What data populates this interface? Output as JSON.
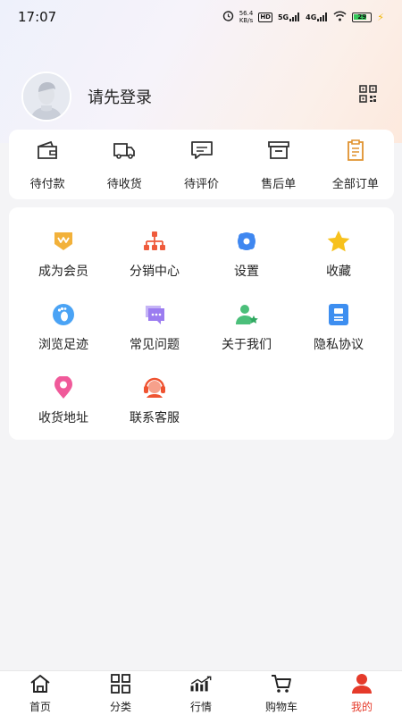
{
  "status_bar": {
    "time": "17:07",
    "net_speed": "56.4",
    "net_unit": "KB/s",
    "hd_label": "HD",
    "net_5g": "5G",
    "net_4g": "4G",
    "battery": "29"
  },
  "profile": {
    "login_prompt": "请先登录"
  },
  "orders": [
    {
      "label": "待付款",
      "icon": "wallet-icon"
    },
    {
      "label": "待收货",
      "icon": "truck-icon"
    },
    {
      "label": "待评价",
      "icon": "comment-icon"
    },
    {
      "label": "售后单",
      "icon": "archive-box-icon"
    },
    {
      "label": "全部订单",
      "icon": "clipboard-icon"
    }
  ],
  "services": [
    {
      "label": "成为会员",
      "icon": "vip-badge-icon"
    },
    {
      "label": "分销中心",
      "icon": "distribution-tree-icon"
    },
    {
      "label": "设置",
      "icon": "gear-icon"
    },
    {
      "label": "收藏",
      "icon": "star-icon"
    },
    {
      "label": "浏览足迹",
      "icon": "footprint-icon"
    },
    {
      "label": "常见问题",
      "icon": "chat-bubble-icon"
    },
    {
      "label": "关于我们",
      "icon": "user-star-icon"
    },
    {
      "label": "隐私协议",
      "icon": "privacy-book-icon"
    },
    {
      "label": "收货地址",
      "icon": "location-pin-icon"
    },
    {
      "label": "联系客服",
      "icon": "headset-icon"
    }
  ],
  "tabbar": [
    {
      "label": "首页",
      "icon": "home-icon"
    },
    {
      "label": "分类",
      "icon": "grid-icon"
    },
    {
      "label": "行情",
      "icon": "trend-chart-icon"
    },
    {
      "label": "购物车",
      "icon": "cart-icon"
    },
    {
      "label": "我的",
      "icon": "person-icon",
      "active": true
    }
  ],
  "colors": {
    "accent": "#e53a2a",
    "vip": "#f2b13a",
    "distribution": "#ef5b3c",
    "settings": "#3f87f0",
    "star": "#f7c11c",
    "footprint": "#4aa3f5",
    "faq": "#9b7cf0",
    "about": "#4bbf7a",
    "privacy": "#3d8ef0",
    "address": "#f05a9a",
    "service": "#ef5331"
  }
}
